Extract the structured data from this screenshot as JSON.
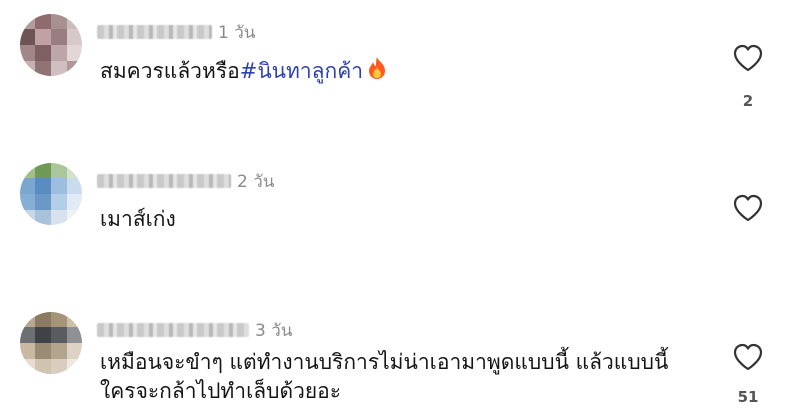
{
  "comments": [
    {
      "time": "1 วัน",
      "text_plain": "สมควรแล้วหรือ",
      "hashtag": "#นินทาลูกค้า",
      "emoji": "fire-icon",
      "likes": "2",
      "avatar_colors": [
        "#b79a9c",
        "#8d6b6e",
        "#a88f90",
        "#cdbcbc",
        "#6d5556",
        "#c0a2a4",
        "#9a7d80",
        "#d8c9c9",
        "#a38688",
        "#7e6063",
        "#bca6a7",
        "#e2d6d6",
        "#c7b1b2",
        "#927375",
        "#d0bfc0",
        "#b19798"
      ]
    },
    {
      "time": "2 วัน",
      "text_plain": "เมาส์เก่ง",
      "likes": "",
      "avatar_colors": [
        "#9fbf8a",
        "#6f9a55",
        "#a9c79a",
        "#d4e2cc",
        "#7aa7d0",
        "#5b8cc0",
        "#9cbfe0",
        "#c9dcee",
        "#86afd6",
        "#6c98c8",
        "#b3cfe8",
        "#e0ebf5",
        "#c7d8e8",
        "#a8c2dc",
        "#d6e3ef",
        "#eef3f8"
      ]
    },
    {
      "time": "3 วัน",
      "text_line1": "เหมือนจะขำๆ แต่ทำงานบริการไม่น่าเอามาพูดแบบนี้ แล้วแบบนี้",
      "text_line2": "ใครจะกล้าไปทำเล็บด้วยอะ",
      "likes": "51",
      "avatar_colors": [
        "#b8a88e",
        "#8c7b63",
        "#a69478",
        "#cdbfa8",
        "#6d6f72",
        "#3f4246",
        "#585b60",
        "#8e9093",
        "#c9b9a2",
        "#9a8b74",
        "#b3a48e",
        "#ddd2c3",
        "#e6ddd0",
        "#cfc3b2",
        "#d8cdbf",
        "#efe9e0"
      ]
    }
  ],
  "icons": {
    "like": "heart-outline-icon"
  }
}
